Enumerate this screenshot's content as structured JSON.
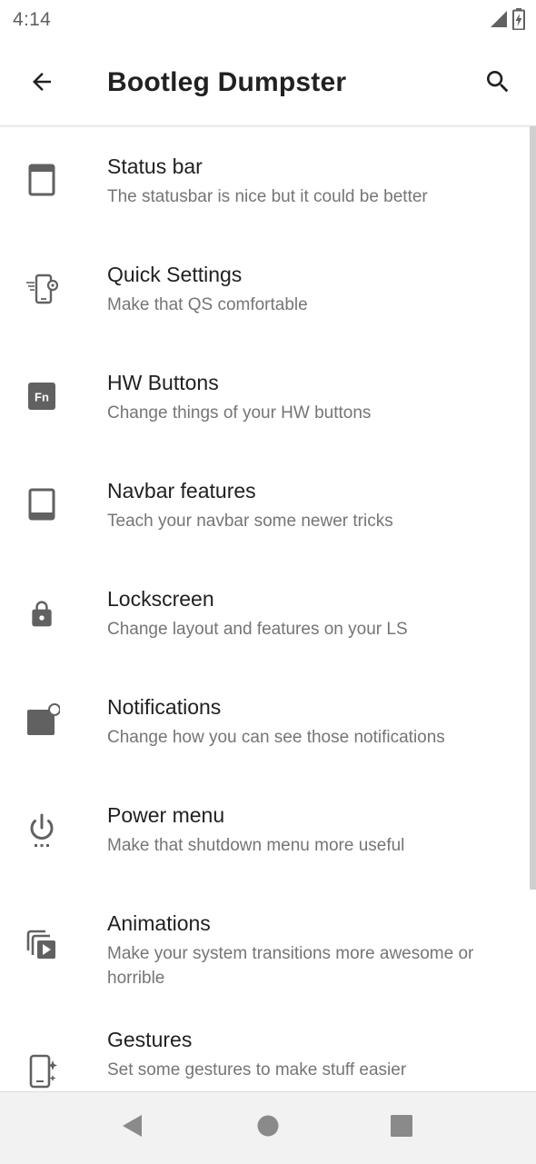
{
  "status_bar": {
    "time": "4:14",
    "icons": [
      "cell-signal-icon",
      "battery-charging-icon"
    ]
  },
  "app_bar": {
    "title": "Bootleg Dumpster",
    "back_icon": "arrow-back-icon",
    "search_icon": "search-icon"
  },
  "items": [
    {
      "icon": "status-bar-icon",
      "title": "Status bar",
      "summary": "The statusbar is nice but it could be better"
    },
    {
      "icon": "quick-settings-icon",
      "title": "Quick Settings",
      "summary": "Make that QS comfortable"
    },
    {
      "icon": "fn-key-icon",
      "title": "HW Buttons",
      "summary": "Change things of your HW buttons"
    },
    {
      "icon": "navbar-icon",
      "title": "Navbar features",
      "summary": "Teach your navbar some newer tricks"
    },
    {
      "icon": "lock-icon",
      "title": "Lockscreen",
      "summary": "Change layout and features on your LS"
    },
    {
      "icon": "notification-icon",
      "title": "Notifications",
      "summary": "Change how you can see those notifications"
    },
    {
      "icon": "power-menu-icon",
      "title": "Power menu",
      "summary": "Make that shutdown menu more useful"
    },
    {
      "icon": "animations-icon",
      "title": "Animations",
      "summary": "Make your system transitions more awesome or horrible"
    },
    {
      "icon": "gestures-icon",
      "title": "Gestures",
      "summary": "Set some gestures to make stuff easier"
    }
  ],
  "nav_bar": {
    "buttons": [
      "back-triangle-icon",
      "home-circle-icon",
      "recents-square-icon"
    ]
  },
  "colors": {
    "icon": "#616161",
    "title": "#212121",
    "summary": "#757575",
    "nav_bar_bg": "#f2f2f2"
  }
}
